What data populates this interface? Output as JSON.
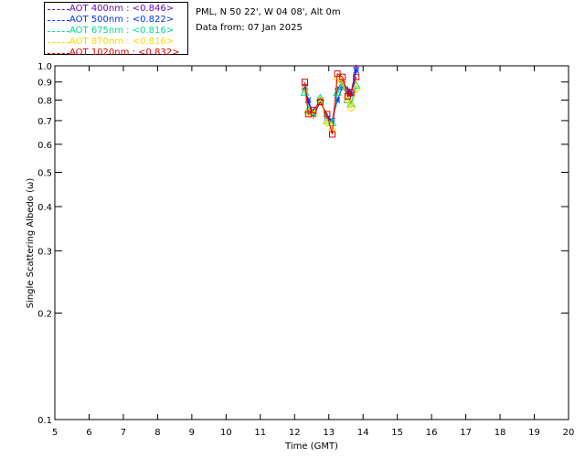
{
  "header": {
    "site_line": "PML, N 50 22', W 04 08', Alt 0m",
    "date_line": "Data from: 07 Jan 2025"
  },
  "legend": [
    {
      "label": "AOT  400nm : <0.846>",
      "color": "#6a0dad"
    },
    {
      "label": "AOT  500nm : <0.822>",
      "color": "#0033ff"
    },
    {
      "label": "AOT  675nm : <0.816>",
      "color": "#00e08a"
    },
    {
      "label": "AOT  870nm : <0.816>",
      "color": "#ffd700"
    },
    {
      "label": "AOT 1020nm : <0.832>",
      "color": "#e00000"
    }
  ],
  "chart_data": {
    "type": "scatter",
    "xlabel": "Time (GMT)",
    "ylabel": "Single Scattering Albedo (ω)",
    "xlim": [
      5,
      20
    ],
    "ylim": [
      0.1,
      1.0
    ],
    "yscale": "log",
    "xticks": [
      "5",
      "6",
      "7",
      "8",
      "9",
      "10",
      "11",
      "12",
      "13",
      "14",
      "15",
      "16",
      "17",
      "18",
      "19",
      "20"
    ],
    "yticks": [
      "1.0",
      "0.9",
      "0.8",
      "0.7",
      "0.6",
      "0.5",
      "0.4",
      "0.3",
      "0.2",
      "0.1"
    ],
    "grid": false,
    "legend_position": "top-left",
    "series": [
      {
        "name": "AOT  400nm : <0.846>",
        "color": "#6a0dad",
        "marker": "plus",
        "x": [
          12.3,
          12.4,
          12.55,
          12.75,
          12.95,
          13.1,
          13.25,
          13.4,
          13.55,
          13.65,
          13.8
        ],
        "y": [
          0.88,
          0.79,
          0.72,
          0.79,
          0.72,
          0.7,
          0.86,
          0.9,
          0.86,
          0.84,
          0.99
        ]
      },
      {
        "name": "AOT  500nm : <0.822>",
        "color": "#0033ff",
        "marker": "star",
        "x": [
          12.3,
          12.4,
          12.55,
          12.75,
          12.95,
          13.1,
          13.25,
          13.4,
          13.55,
          13.65,
          13.8
        ],
        "y": [
          0.86,
          0.8,
          0.73,
          0.8,
          0.71,
          0.7,
          0.8,
          0.87,
          0.84,
          0.83,
          0.97
        ]
      },
      {
        "name": "AOT  675nm : <0.816>",
        "color": "#00e08a",
        "marker": "triangle",
        "x": [
          12.3,
          12.4,
          12.55,
          12.75,
          12.95,
          13.1,
          13.25,
          13.4,
          13.55,
          13.65,
          13.8
        ],
        "y": [
          0.84,
          0.75,
          0.74,
          0.81,
          0.7,
          0.69,
          0.84,
          0.88,
          0.8,
          0.78,
          0.88
        ]
      },
      {
        "name": "AOT  870nm : <0.816>",
        "color": "#ffd700",
        "marker": "diamond",
        "x": [
          12.3,
          12.4,
          12.55,
          12.75,
          12.95,
          13.1,
          13.25,
          13.4,
          13.55,
          13.65,
          13.8
        ],
        "y": [
          0.86,
          0.74,
          0.73,
          0.8,
          0.69,
          0.66,
          0.92,
          0.9,
          0.8,
          0.76,
          0.86
        ]
      },
      {
        "name": "AOT 1020nm : <0.832>",
        "color": "#e00000",
        "marker": "square",
        "x": [
          12.3,
          12.4,
          12.55,
          12.75,
          12.95,
          13.1,
          13.25,
          13.4,
          13.55,
          13.65,
          13.8
        ],
        "y": [
          0.9,
          0.73,
          0.75,
          0.79,
          0.73,
          0.64,
          0.95,
          0.93,
          0.82,
          0.84,
          0.93
        ]
      }
    ]
  }
}
